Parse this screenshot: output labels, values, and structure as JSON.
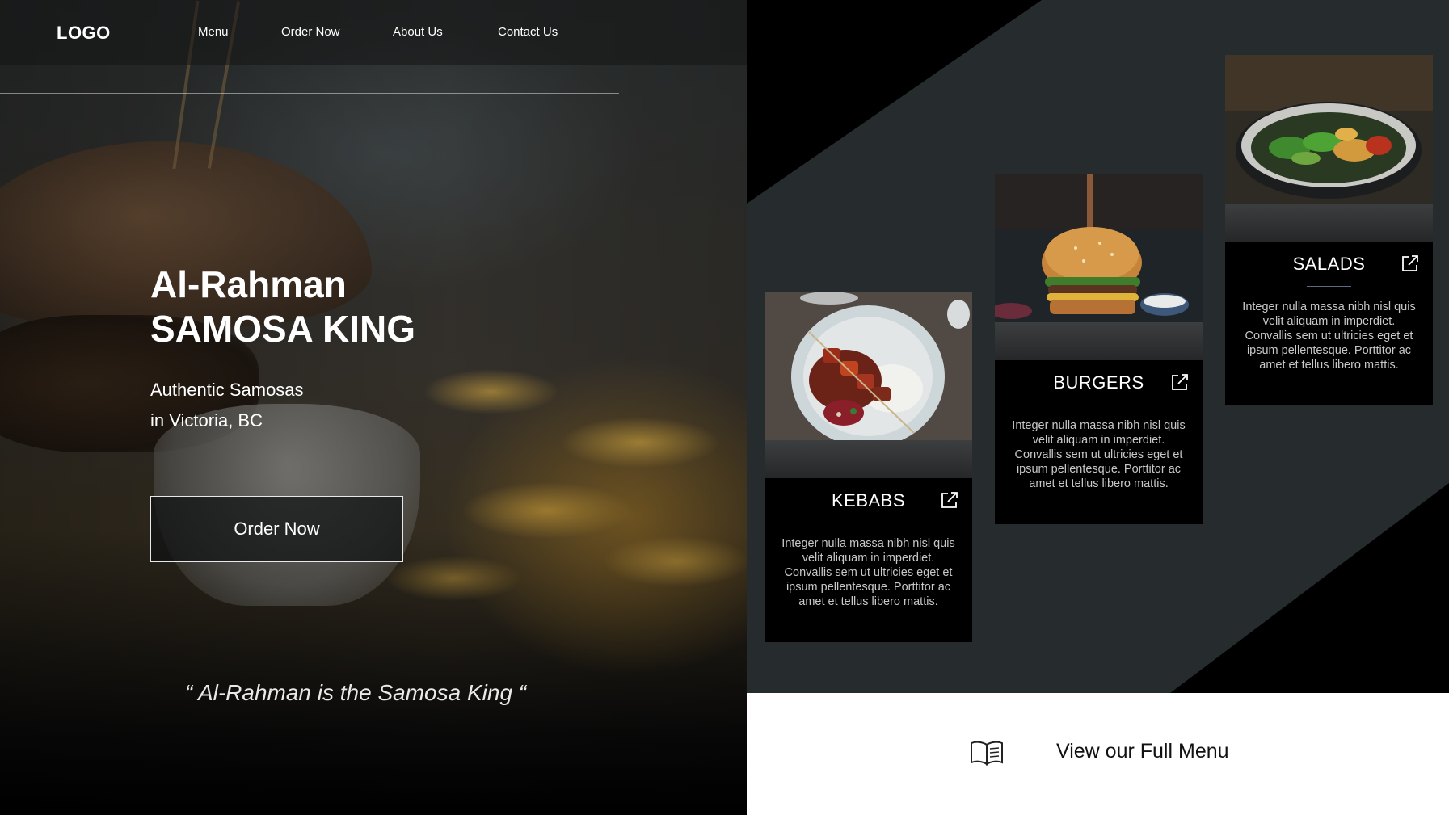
{
  "nav": {
    "logo": "LOGO",
    "links": [
      "Menu",
      "Order Now",
      "About Us",
      "Contact Us"
    ]
  },
  "hero": {
    "title_line1": "Al-Rahman",
    "title_line2": "SAMOSA KING",
    "subtitle_line1": "Authentic Samosas",
    "subtitle_line2": "in Victoria, BC",
    "cta_label": "Order Now",
    "quote": "“ Al-Rahman is the Samosa King “"
  },
  "cards": [
    {
      "title": "KEBABS",
      "description": "Integer nulla massa nibh nisl quis velit aliquam in imperdiet. Convallis sem ut ultricies eget et ipsum pellentesque. Porttitor ac amet et tellus libero mattis.",
      "icon": "external-link-icon"
    },
    {
      "title": "BURGERS",
      "description": "Integer nulla massa nibh nisl quis velit aliquam in imperdiet. Convallis sem ut ultricies eget et ipsum pellentesque. Porttitor ac amet et tellus libero mattis.",
      "icon": "external-link-icon"
    },
    {
      "title": "SALADS",
      "description": "Integer nulla massa nibh nisl quis velit aliquam in imperdiet. Convallis sem ut ultricies eget et ipsum pellentesque. Porttitor ac amet et tellus libero mattis.",
      "icon": "external-link-icon"
    }
  ],
  "full_menu": {
    "label": "View our Full Menu",
    "icon": "open-book-icon"
  },
  "colors": {
    "panel_bg": "#262c2e",
    "card_bg": "#000000",
    "accent_rule": "#5a6a80",
    "text_light": "#ffffff"
  }
}
